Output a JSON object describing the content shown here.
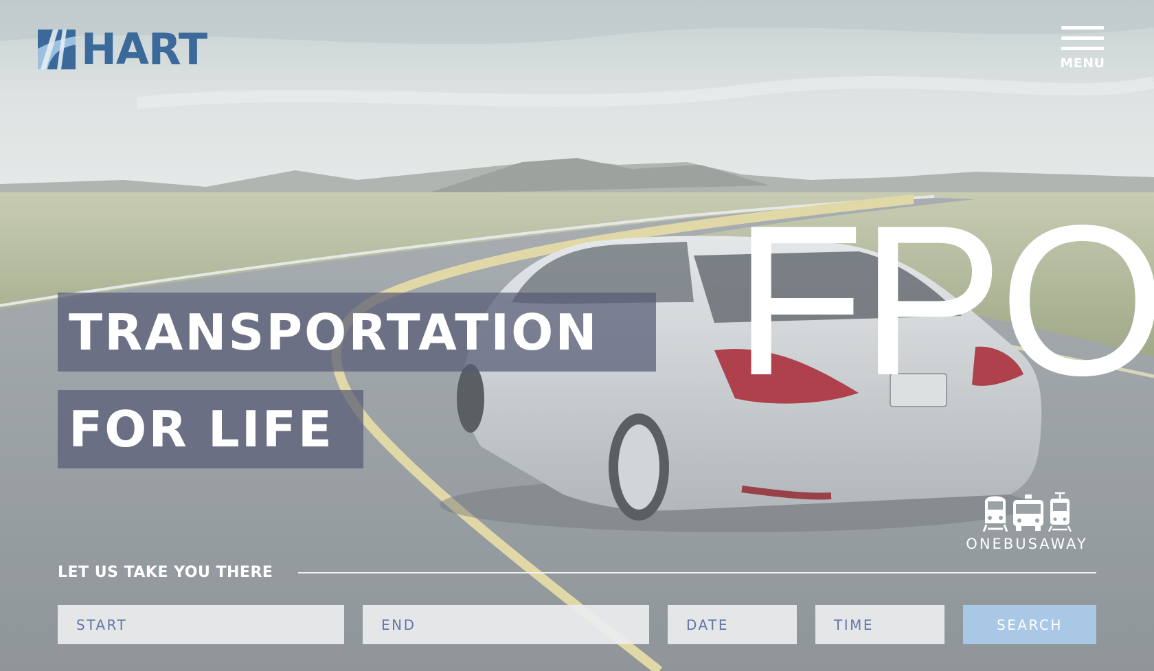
{
  "brand": {
    "name": "HART",
    "color": "#3b6a9a",
    "light": "#9dc0e0"
  },
  "menu": {
    "label": "MENU",
    "icon": "hamburger-icon"
  },
  "hero": {
    "placeholder_mark": "FPO",
    "headline_line1": "TRANSPORTATION",
    "headline_line2": "FOR LIFE"
  },
  "onebusaway": {
    "label": "ONEBUSAWAY",
    "icons": [
      "train-icon",
      "bus-icon",
      "streetcar-icon"
    ]
  },
  "trip_planner": {
    "tagline": "LET US TAKE YOU THERE",
    "start_placeholder": "START",
    "end_placeholder": "END",
    "date_placeholder": "DATE",
    "time_placeholder": "TIME",
    "search_label": "SEARCH",
    "search_color": "#a8c8e6"
  }
}
